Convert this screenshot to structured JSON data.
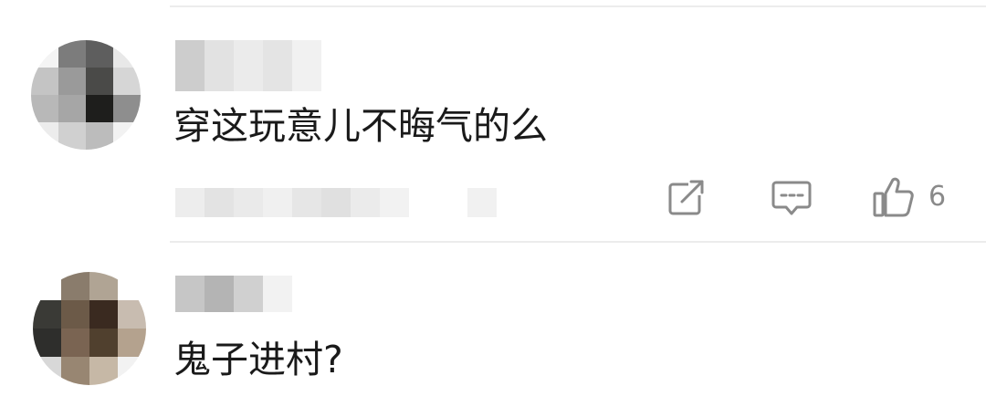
{
  "comments": [
    {
      "text": "穿这玩意儿不晦气的么",
      "actions": {
        "share_icon": "share-external-icon",
        "reply_icon": "comment-bubble-icon",
        "like_icon": "thumbs-up-icon",
        "like_count": "6"
      }
    },
    {
      "text": "鬼子进村?"
    }
  ],
  "colors": {
    "text": "#1a1a1a",
    "icon": "#8a8a8a",
    "divider": "#ececec"
  }
}
